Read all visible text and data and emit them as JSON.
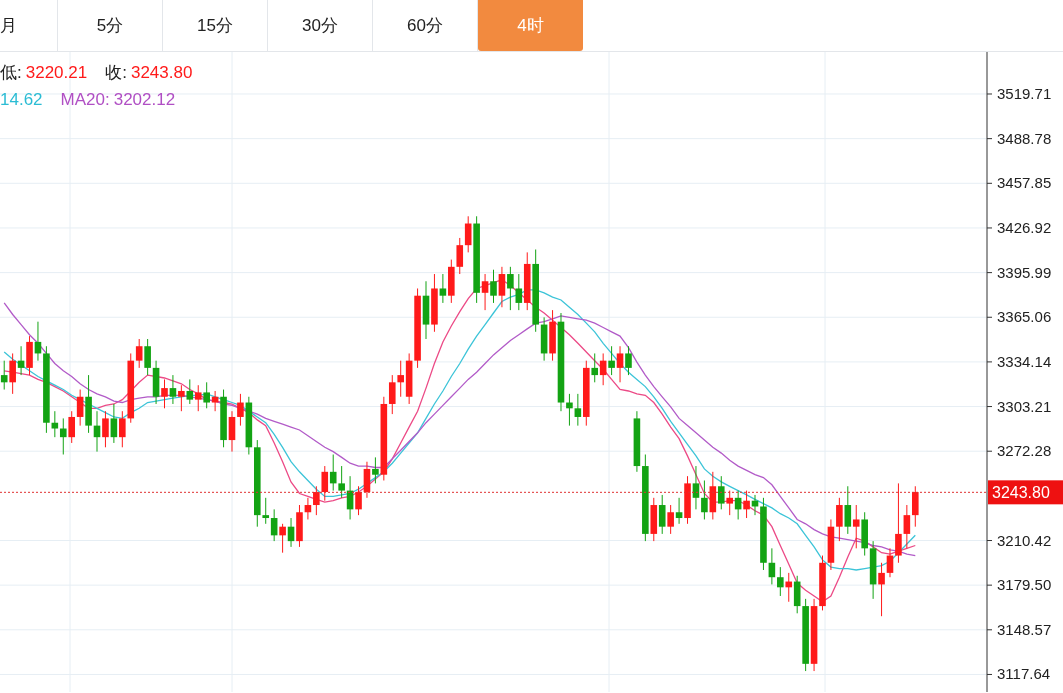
{
  "tabs": [
    {
      "label": "月",
      "selected": false
    },
    {
      "label": "5分",
      "selected": false
    },
    {
      "label": "15分",
      "selected": false
    },
    {
      "label": "30分",
      "selected": false
    },
    {
      "label": "60分",
      "selected": false
    },
    {
      "label": "4时",
      "selected": true
    }
  ],
  "legend": [
    [
      {
        "label": "低:",
        "value": "3220.21",
        "color": "#ff1a1a"
      },
      {
        "label": "收:",
        "value": "3243.80",
        "color": "#ff1a1a"
      }
    ],
    [
      {
        "value": "14.62",
        "color": "#2bbcd4"
      },
      {
        "label": "MA20:",
        "value": "3202.12",
        "color": "#b04fc4"
      }
    ]
  ],
  "chart_data": {
    "type": "candlestick",
    "ylim": [
      3104.8,
      3548.8
    ],
    "ref_lines": [
      {
        "axis": "y",
        "value": 3243.8,
        "label": "3243.80",
        "color": "#e03030"
      }
    ],
    "grid": true,
    "yticks": [
      3519.71,
      3488.78,
      3457.85,
      3426.92,
      3395.99,
      3365.06,
      3334.14,
      3303.21,
      3272.28,
      3210.42,
      {
        "value": 3179.5,
        "label": "3179.50"
      },
      3148.57,
      3117.64
    ],
    "ohlc": [
      [
        3325,
        3335,
        3315,
        3320
      ],
      [
        3320,
        3340,
        3312,
        3335
      ],
      [
        3335,
        3345,
        3325,
        3330
      ],
      [
        3330,
        3352,
        3325,
        3348
      ],
      [
        3348,
        3362,
        3335,
        3340
      ],
      [
        3340,
        3345,
        3285,
        3292
      ],
      [
        3292,
        3300,
        3282,
        3288
      ],
      [
        3288,
        3295,
        3270,
        3282
      ],
      [
        3282,
        3300,
        3278,
        3296
      ],
      [
        3296,
        3315,
        3290,
        3310
      ],
      [
        3310,
        3325,
        3285,
        3290
      ],
      [
        3290,
        3300,
        3272,
        3282
      ],
      [
        3282,
        3300,
        3275,
        3295
      ],
      [
        3295,
        3305,
        3278,
        3282
      ],
      [
        3282,
        3300,
        3275,
        3295
      ],
      [
        3295,
        3340,
        3292,
        3335
      ],
      [
        3335,
        3350,
        3330,
        3345
      ],
      [
        3345,
        3350,
        3325,
        3330
      ],
      [
        3330,
        3335,
        3305,
        3310
      ],
      [
        3310,
        3322,
        3302,
        3316
      ],
      [
        3316,
        3325,
        3305,
        3310
      ],
      [
        3310,
        3318,
        3300,
        3314
      ],
      [
        3314,
        3322,
        3305,
        3308
      ],
      [
        3308,
        3318,
        3300,
        3313
      ],
      [
        3313,
        3320,
        3302,
        3306
      ],
      [
        3306,
        3314,
        3300,
        3310
      ],
      [
        3310,
        3315,
        3275,
        3280
      ],
      [
        3280,
        3300,
        3272,
        3296
      ],
      [
        3296,
        3312,
        3290,
        3306
      ],
      [
        3306,
        3310,
        3270,
        3275
      ],
      [
        3275,
        3280,
        3220,
        3228
      ],
      [
        3228,
        3240,
        3222,
        3226
      ],
      [
        3226,
        3232,
        3210,
        3214
      ],
      [
        3214,
        3222,
        3202,
        3220
      ],
      [
        3220,
        3226,
        3206,
        3210
      ],
      [
        3210,
        3235,
        3206,
        3230
      ],
      [
        3230,
        3240,
        3225,
        3235
      ],
      [
        3235,
        3248,
        3228,
        3244
      ],
      [
        3244,
        3262,
        3238,
        3258
      ],
      [
        3258,
        3270,
        3245,
        3250
      ],
      [
        3250,
        3262,
        3240,
        3245
      ],
      [
        3245,
        3255,
        3225,
        3232
      ],
      [
        3232,
        3248,
        3228,
        3244
      ],
      [
        3244,
        3265,
        3240,
        3260
      ],
      [
        3260,
        3268,
        3250,
        3256
      ],
      [
        3256,
        3310,
        3252,
        3305
      ],
      [
        3305,
        3325,
        3298,
        3320
      ],
      [
        3320,
        3335,
        3310,
        3325
      ],
      [
        3310,
        3340,
        3305,
        3335
      ],
      [
        3335,
        3385,
        3330,
        3380
      ],
      [
        3380,
        3390,
        3350,
        3360
      ],
      [
        3360,
        3395,
        3355,
        3385
      ],
      [
        3385,
        3395,
        3375,
        3380
      ],
      [
        3380,
        3405,
        3375,
        3400
      ],
      [
        3400,
        3420,
        3395,
        3415
      ],
      [
        3415,
        3435,
        3410,
        3430
      ],
      [
        3430,
        3435,
        3375,
        3382
      ],
      [
        3382,
        3395,
        3370,
        3390
      ],
      [
        3390,
        3398,
        3375,
        3380
      ],
      [
        3380,
        3400,
        3372,
        3395
      ],
      [
        3395,
        3400,
        3370,
        3385
      ],
      [
        3385,
        3395,
        3370,
        3375
      ],
      [
        3375,
        3410,
        3370,
        3402
      ],
      [
        3402,
        3412,
        3355,
        3360
      ],
      [
        3360,
        3365,
        3335,
        3340
      ],
      [
        3340,
        3370,
        3335,
        3362
      ],
      [
        3362,
        3368,
        3300,
        3306
      ],
      [
        3306,
        3312,
        3290,
        3302
      ],
      [
        3302,
        3312,
        3290,
        3296
      ],
      [
        3296,
        3335,
        3290,
        3330
      ],
      [
        3330,
        3340,
        3320,
        3325
      ],
      [
        3325,
        3340,
        3318,
        3335
      ],
      [
        3335,
        3345,
        3325,
        3330
      ],
      [
        3330,
        3345,
        3320,
        3340
      ],
      [
        3340,
        3345,
        3325,
        3330
      ],
      [
        3295,
        3300,
        3258,
        3262
      ],
      [
        3262,
        3270,
        3210,
        3215
      ],
      [
        3215,
        3240,
        3210,
        3235
      ],
      [
        3235,
        3242,
        3215,
        3220
      ],
      [
        3220,
        3235,
        3215,
        3230
      ],
      [
        3230,
        3240,
        3222,
        3226
      ],
      [
        3226,
        3255,
        3222,
        3250
      ],
      [
        3250,
        3262,
        3232,
        3240
      ],
      [
        3240,
        3252,
        3225,
        3230
      ],
      [
        3230,
        3258,
        3225,
        3248
      ],
      [
        3248,
        3255,
        3232,
        3236
      ],
      [
        3236,
        3245,
        3228,
        3240
      ],
      [
        3240,
        3245,
        3225,
        3232
      ],
      [
        3232,
        3245,
        3226,
        3238
      ],
      [
        3238,
        3242,
        3228,
        3234
      ],
      [
        3234,
        3240,
        3190,
        3195
      ],
      [
        3195,
        3205,
        3180,
        3185
      ],
      [
        3185,
        3192,
        3172,
        3178
      ],
      [
        3178,
        3188,
        3168,
        3182
      ],
      [
        3182,
        3186,
        3160,
        3165
      ],
      [
        3165,
        3170,
        3120,
        3125
      ],
      [
        3125,
        3170,
        3120,
        3165
      ],
      [
        3165,
        3200,
        3162,
        3195
      ],
      [
        3195,
        3225,
        3190,
        3220
      ],
      [
        3220,
        3240,
        3210,
        3235
      ],
      [
        3235,
        3248,
        3215,
        3220
      ],
      [
        3220,
        3235,
        3205,
        3225
      ],
      [
        3225,
        3230,
        3200,
        3205
      ],
      [
        3205,
        3210,
        3170,
        3180
      ],
      [
        3180,
        3195,
        3158,
        3188
      ],
      [
        3188,
        3205,
        3185,
        3200
      ],
      [
        3200,
        3250,
        3195,
        3215
      ],
      [
        3215,
        3235,
        3205,
        3228
      ],
      [
        3228,
        3248,
        3220,
        3244
      ],
      null,
      null,
      null,
      null,
      null,
      null,
      null,
      null
    ],
    "series": [
      {
        "type": "line",
        "color": "#ec4a86",
        "values": [
          3328,
          3327,
          3326,
          3325,
          3322,
          3320,
          3317,
          3314,
          3310,
          3306,
          3302,
          3302,
          3304,
          3305,
          3308,
          3314,
          3320,
          3325,
          3324,
          3323,
          3321,
          3319,
          3315,
          3312,
          3308,
          3307,
          3306,
          3305,
          3302,
          3299,
          3294,
          3290,
          3278,
          3265,
          3251,
          3243,
          3241,
          3239,
          3237,
          3238,
          3240,
          3241,
          3244,
          3248,
          3253,
          3258,
          3267,
          3278,
          3289,
          3300,
          3316,
          3333,
          3348,
          3359,
          3369,
          3378,
          3385,
          3387,
          3389,
          3391,
          3387,
          3382,
          3377,
          3372,
          3368,
          3363,
          3358,
          3353,
          3347,
          3341,
          3335,
          3329,
          3322,
          3315,
          3314,
          3312,
          3311,
          3306,
          3298,
          3289,
          3281,
          3269,
          3256,
          3243,
          3237,
          3237,
          3238,
          3238,
          3235,
          3231,
          3228,
          3220,
          3207,
          3194,
          3181,
          3176,
          3172,
          3168,
          3172,
          3185,
          3199,
          3212,
          3210,
          3206,
          3202,
          3201,
          3203,
          3205,
          3207,
          null,
          null,
          null,
          null,
          null,
          null,
          null,
          null
        ]
      },
      {
        "type": "line",
        "color": "#3cc4d8",
        "values": [
          3341,
          3336,
          3332,
          3328,
          3324,
          3321,
          3318,
          3315,
          3311,
          3308,
          3305,
          3302,
          3299,
          3296,
          3295,
          3299,
          3302,
          3306,
          3307,
          3308,
          3309,
          3310,
          3311,
          3311,
          3312,
          3310,
          3308,
          3306,
          3304,
          3300,
          3296,
          3292,
          3284,
          3275,
          3265,
          3258,
          3252,
          3246,
          3241,
          3241,
          3242,
          3243,
          3246,
          3250,
          3254,
          3258,
          3264,
          3271,
          3278,
          3285,
          3295,
          3305,
          3314,
          3324,
          3333,
          3343,
          3352,
          3360,
          3368,
          3376,
          3379,
          3381,
          3384,
          3384,
          3382,
          3379,
          3377,
          3372,
          3367,
          3361,
          3355,
          3347,
          3340,
          3333,
          3327,
          3322,
          3317,
          3310,
          3302,
          3293,
          3285,
          3277,
          3269,
          3260,
          3255,
          3251,
          3248,
          3245,
          3242,
          3239,
          3236,
          3233,
          3229,
          3226,
          3222,
          3214,
          3206,
          3197,
          3192,
          3191,
          3191,
          3190,
          3191,
          3192,
          3193,
          3196,
          3202,
          3208,
          3214,
          null,
          null,
          null,
          null,
          null,
          null,
          null,
          null
        ]
      },
      {
        "type": "line",
        "color": "#b25bc8",
        "values": [
          3375,
          3367,
          3360,
          3353,
          3347,
          3340,
          3333,
          3328,
          3324,
          3319,
          3315,
          3312,
          3310,
          3307,
          3306,
          3308,
          3309,
          3310,
          3310,
          3311,
          3311,
          3311,
          3310,
          3309,
          3308,
          3307,
          3305,
          3304,
          3302,
          3300,
          3298,
          3295,
          3293,
          3291,
          3289,
          3287,
          3283,
          3279,
          3275,
          3272,
          3268,
          3264,
          3262,
          3262,
          3261,
          3261,
          3267,
          3273,
          3279,
          3285,
          3292,
          3298,
          3304,
          3310,
          3316,
          3322,
          3327,
          3333,
          3339,
          3344,
          3349,
          3353,
          3357,
          3361,
          3362,
          3364,
          3366,
          3365,
          3364,
          3363,
          3361,
          3358,
          3355,
          3352,
          3344,
          3334,
          3325,
          3317,
          3310,
          3303,
          3295,
          3290,
          3285,
          3280,
          3275,
          3271,
          3266,
          3262,
          3259,
          3256,
          3254,
          3249,
          3241,
          3233,
          3225,
          3222,
          3218,
          3215,
          3213,
          3212,
          3211,
          3210,
          3209,
          3207,
          3206,
          3204,
          3203,
          3201,
          3200,
          null,
          null,
          null,
          null,
          null,
          null,
          null,
          null
        ]
      }
    ]
  }
}
